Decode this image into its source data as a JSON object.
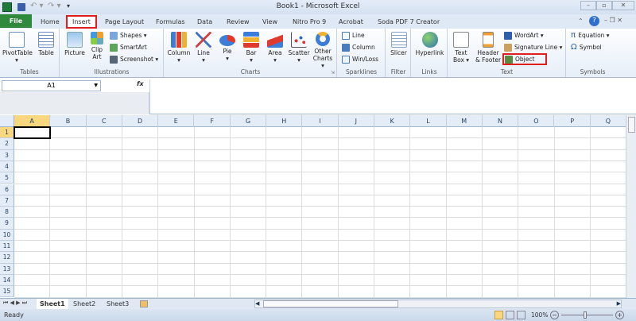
{
  "window": {
    "title": "Book1 - Microsoft Excel",
    "controls": [
      "minimize",
      "restore",
      "close"
    ]
  },
  "tabs": [
    {
      "label": "File"
    },
    {
      "label": "Home"
    },
    {
      "label": "Insert",
      "active": true
    },
    {
      "label": "Page Layout"
    },
    {
      "label": "Formulas"
    },
    {
      "label": "Data"
    },
    {
      "label": "Review"
    },
    {
      "label": "View"
    },
    {
      "label": "Nitro Pro 9"
    },
    {
      "label": "Acrobat"
    },
    {
      "label": "Soda PDF 7 Creator"
    }
  ],
  "ribbon": {
    "tables": {
      "label": "Tables",
      "items": [
        "PivotTable",
        "Table"
      ]
    },
    "illustrations": {
      "label": "Illustrations",
      "picture": "Picture",
      "clipart1": "Clip",
      "clipart2": "Art",
      "shapes": "Shapes",
      "smartart": "SmartArt",
      "screenshot": "Screenshot"
    },
    "charts": {
      "label": "Charts",
      "items": [
        "Column",
        "Line",
        "Pie",
        "Bar",
        "Area",
        "Scatter"
      ],
      "other1": "Other",
      "other2": "Charts"
    },
    "sparklines": {
      "label": "Sparklines",
      "items": [
        "Line",
        "Column",
        "Win/Loss"
      ]
    },
    "filter": {
      "label": "Filter",
      "slicer": "Slicer"
    },
    "links": {
      "label": "Links",
      "hyperlink": "Hyperlink"
    },
    "text": {
      "label": "Text",
      "textbox1": "Text",
      "textbox2": "Box",
      "header1": "Header",
      "header2": "& Footer",
      "wordart": "WordArt",
      "signature": "Signature Line",
      "object": "Object"
    },
    "symbols": {
      "label": "Symbols",
      "equation": "Equation",
      "symbol": "Symbol"
    }
  },
  "formula_bar": {
    "name_box": "A1",
    "fx": "fx",
    "value": ""
  },
  "columns": [
    "A",
    "B",
    "C",
    "D",
    "E",
    "F",
    "G",
    "H",
    "I",
    "J",
    "K",
    "L",
    "M",
    "N",
    "O",
    "P",
    "Q"
  ],
  "rows": [
    "1",
    "2",
    "3",
    "4",
    "5",
    "6",
    "7",
    "8",
    "9",
    "10",
    "11",
    "12",
    "13",
    "14",
    "15"
  ],
  "active_cell": "A1",
  "sheets": [
    "Sheet1",
    "Sheet2",
    "Sheet3"
  ],
  "active_sheet": "Sheet1",
  "status": {
    "text": "Ready",
    "zoom": "100%"
  },
  "colors": {
    "file_tab": "#2f8a3e",
    "highlight": "#e01e1e",
    "active_header": "#f9d77e"
  }
}
